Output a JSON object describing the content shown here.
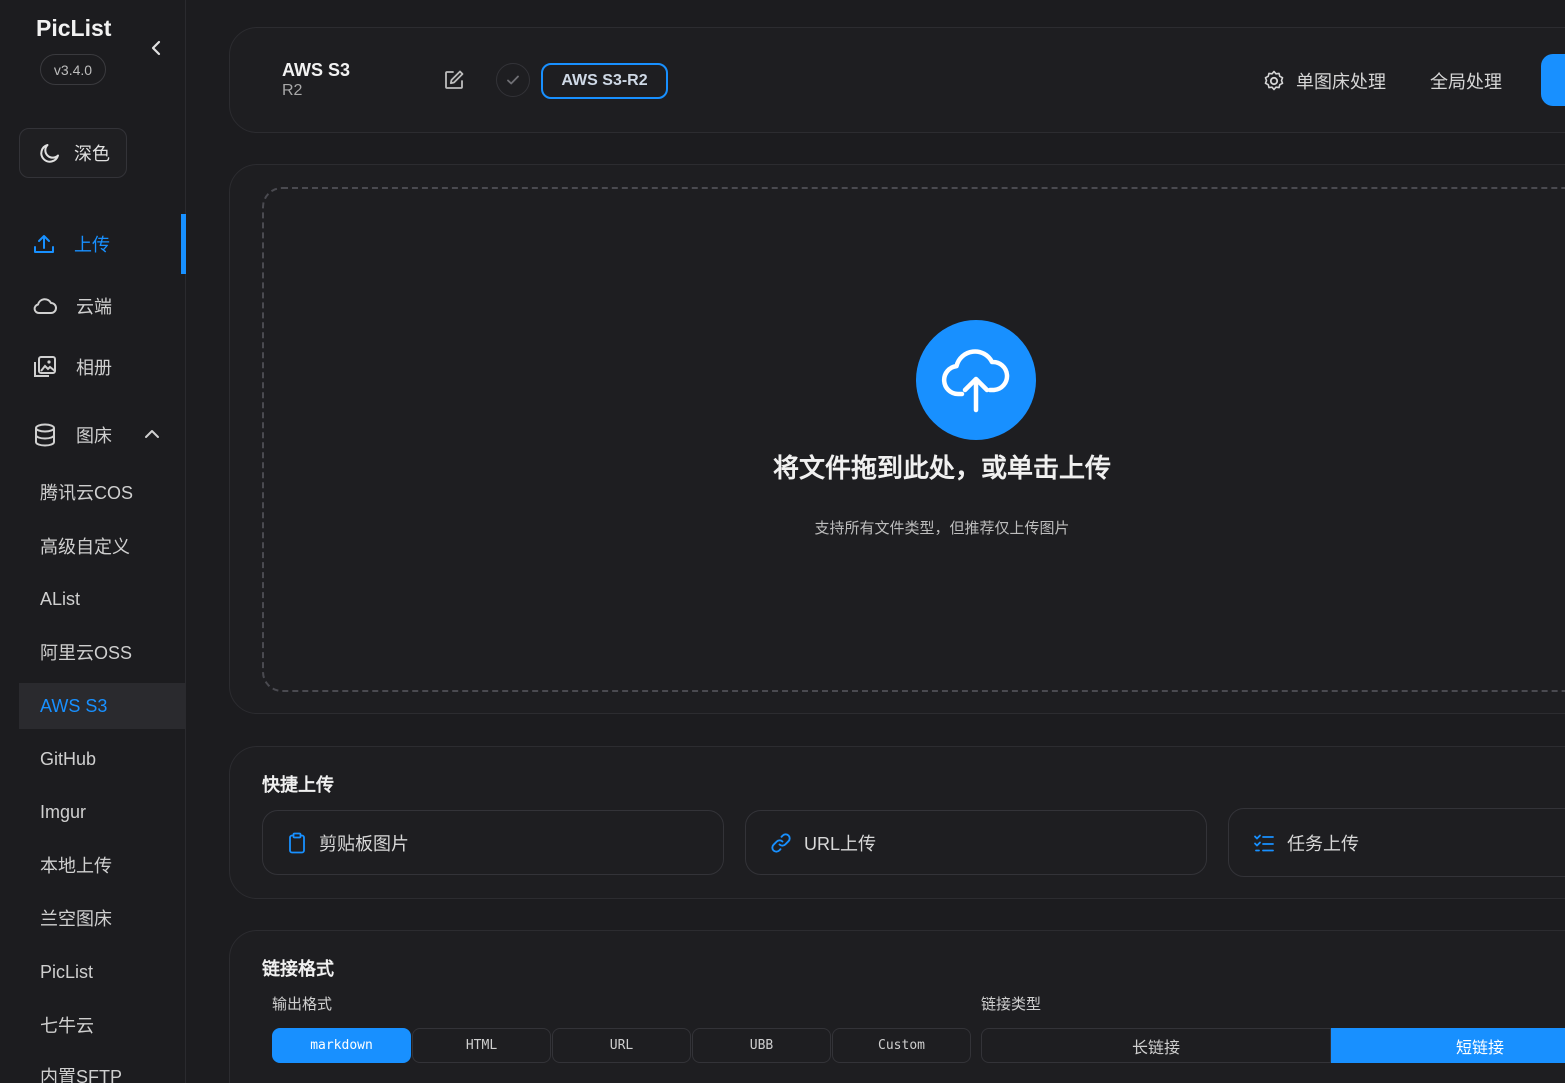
{
  "app": {
    "name": "PicList",
    "version": "v3.4.0"
  },
  "theme_toggle": {
    "label": "深色"
  },
  "nav": {
    "upload": "上传",
    "cloud": "云端",
    "album": "相册",
    "picbed": "图床"
  },
  "picbeds": [
    "腾讯云COS",
    "高级自定义",
    "AList",
    "阿里云OSS",
    "AWS S3",
    "GitHub",
    "Imgur",
    "本地上传",
    "兰空图床",
    "PicList",
    "七牛云",
    "内置SFTP"
  ],
  "active_picbed": "AWS S3",
  "topbar": {
    "title": "AWS S3",
    "subtitle": "R2",
    "config_tag": "AWS S3-R2",
    "single_process": "单图床处理",
    "global_process": "全局处理"
  },
  "dropzone": {
    "title": "将文件拖到此处，或单击上传",
    "subtitle": "支持所有文件类型，但推荐仅上传图片"
  },
  "quick_upload": {
    "title": "快捷上传",
    "clipboard": "剪贴板图片",
    "url": "URL上传",
    "task": "任务上传"
  },
  "link_format": {
    "title": "链接格式",
    "output_label": "输出格式",
    "formats": [
      "markdown",
      "HTML",
      "URL",
      "UBB",
      "Custom"
    ],
    "selected_format": "markdown",
    "link_type_label": "链接类型",
    "link_types": [
      "长链接",
      "短链接"
    ],
    "selected_link_type": "短链接"
  },
  "colors": {
    "accent": "#1890ff",
    "background": "#1c1c1f"
  }
}
